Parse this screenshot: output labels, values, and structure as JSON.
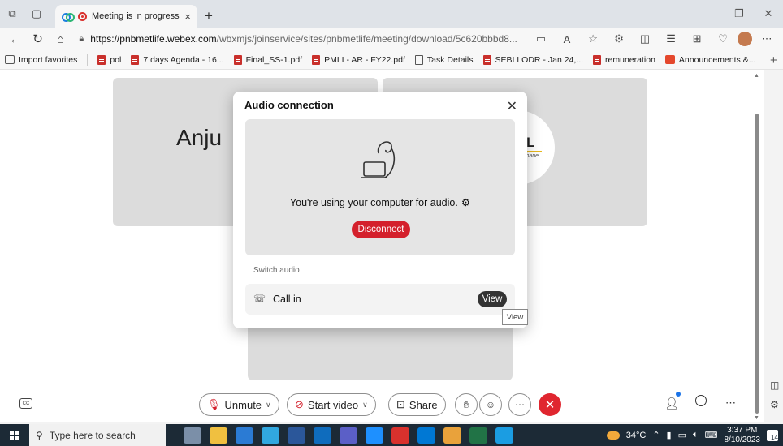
{
  "browser": {
    "tab_title": "Meeting is in progress...",
    "tab_close": "×",
    "new_tab": "+",
    "url_host": "https://pnbmetlife.webex.com",
    "url_path": "/wbxmjs/joinservice/sites/pnbmetlife/meeting/download/5c620bbbd8...",
    "favorites": [
      {
        "label": "Import favorites",
        "icon": "import-icon"
      },
      {
        "label": "pol",
        "icon": "pdf-icon"
      },
      {
        "label": "7 days Agenda - 16...",
        "icon": "pdf-icon"
      },
      {
        "label": "Final_SS-1.pdf",
        "icon": "pdf-icon"
      },
      {
        "label": "PMLI - AR - FY22.pdf",
        "icon": "pdf-icon"
      },
      {
        "label": "Task Details",
        "icon": "file-icon"
      },
      {
        "label": "SEBI LODR - Jan 24,...",
        "icon": "pdf-icon"
      },
      {
        "label": "remuneration",
        "icon": "pdf-icon"
      },
      {
        "label": "Announcements &...",
        "icon": "announcement-icon"
      }
    ]
  },
  "meeting": {
    "participant_name": "Anju",
    "logo_text": "etL",
    "logo_sub": "Sadhane"
  },
  "dialog": {
    "title": "Audio connection",
    "status_text": "You're using your computer for audio.",
    "disconnect_label": "Disconnect",
    "switch_label": "Switch audio",
    "callin_label": "Call in",
    "view_label": "View",
    "tooltip": "View"
  },
  "controls": {
    "unmute_label": "Unmute",
    "start_video_label": "Start video",
    "share_label": "Share"
  },
  "taskbar": {
    "search_placeholder": "Type here to search",
    "temperature": "34°C",
    "time": "3:37 PM",
    "date": "8/10/2023",
    "notification_count": "14"
  },
  "colors": {
    "accent_red": "#d4202c",
    "webex_blue": "#1b7ee0"
  }
}
